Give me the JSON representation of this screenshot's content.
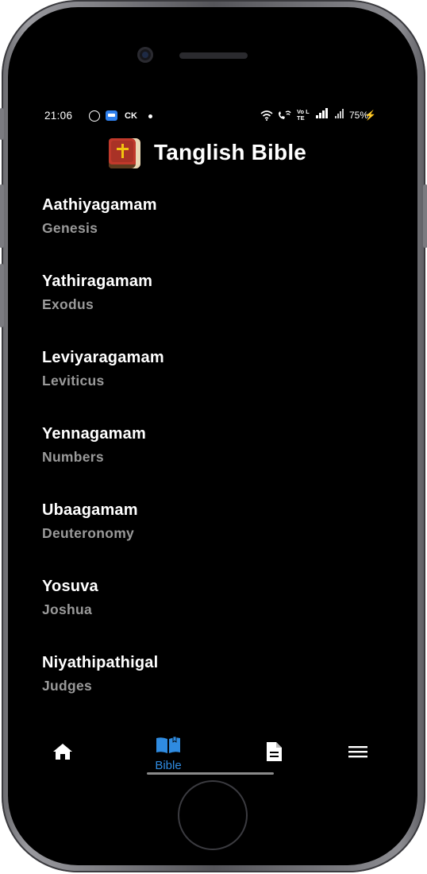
{
  "status_bar": {
    "time": "21:06",
    "carrier_badge": "CK",
    "volte": "Vo LTE",
    "battery": "75%",
    "icons": [
      "whatsapp-icon",
      "message-icon",
      "wifi-icon",
      "wifi-calling-icon",
      "signal-icon",
      "charging-icon"
    ]
  },
  "header": {
    "title": "Tanglish Bible",
    "logo_icon": "bible-book-icon"
  },
  "books": [
    {
      "name": "Aathiyagamam",
      "english": "Genesis"
    },
    {
      "name": "Yathiragamam",
      "english": "Exodus"
    },
    {
      "name": "Leviyaragamam",
      "english": "Leviticus"
    },
    {
      "name": "Yennagamam",
      "english": "Numbers"
    },
    {
      "name": "Ubaagamam",
      "english": "Deuteronomy"
    },
    {
      "name": "Yosuva",
      "english": "Joshua"
    },
    {
      "name": "Niyathipathigal",
      "english": "Judges"
    }
  ],
  "bottom_nav": {
    "items": [
      {
        "icon": "home-icon",
        "label": ""
      },
      {
        "icon": "open-book-icon",
        "label": "Bible",
        "active": true
      },
      {
        "icon": "document-icon",
        "label": ""
      },
      {
        "icon": "menu-icon",
        "label": ""
      }
    ],
    "active_color": "#2f8be0"
  }
}
